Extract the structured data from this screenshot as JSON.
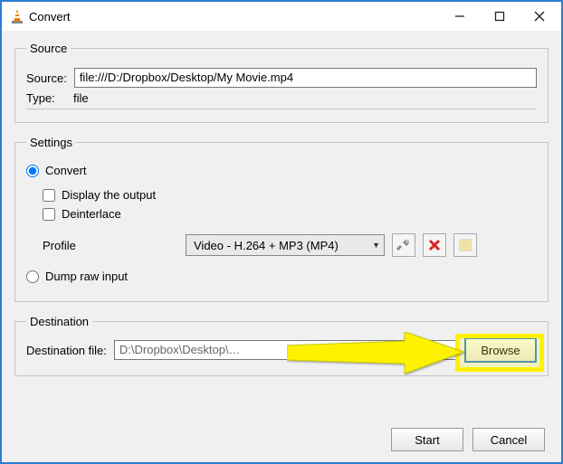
{
  "window": {
    "title": "Convert"
  },
  "source": {
    "legend": "Source",
    "sourceLabel": "Source:",
    "sourceValue": "file:///D:/Dropbox/Desktop/My Movie.mp4",
    "typeLabel": "Type:",
    "typeValue": "file"
  },
  "settings": {
    "legend": "Settings",
    "convertLabel": "Convert",
    "displayOutputLabel": "Display the output",
    "deinterlaceLabel": "Deinterlace",
    "profileLabel": "Profile",
    "profileSelected": "Video - H.264 + MP3 (MP4)",
    "dumpRawLabel": "Dump raw input"
  },
  "destination": {
    "legend": "Destination",
    "fileLabel": "Destination file:",
    "fileValue": "D:\\Dropbox\\Desktop\\…",
    "browseLabel": "Browse"
  },
  "footer": {
    "startLabel": "Start",
    "cancelLabel": "Cancel"
  }
}
